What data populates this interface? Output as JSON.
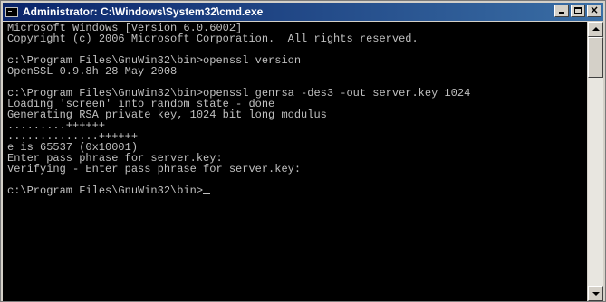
{
  "window": {
    "title": "Administrator: C:\\Windows\\System32\\cmd.exe",
    "app_icon": "cmd-console-icon",
    "controls": {
      "minimize": "minimize-icon",
      "maximize": "maximize-icon",
      "close": "×"
    }
  },
  "console": {
    "foreground": "#c0c0c0",
    "background": "#000000",
    "lines": [
      "Microsoft Windows [Version 6.0.6002]",
      "Copyright (c) 2006 Microsoft Corporation.  All rights reserved.",
      "",
      "c:\\Program Files\\GnuWin32\\bin>openssl version",
      "OpenSSL 0.9.8h 28 May 2008",
      "",
      "c:\\Program Files\\GnuWin32\\bin>openssl genrsa -des3 -out server.key 1024",
      "Loading 'screen' into random state - done",
      "Generating RSA private key, 1024 bit long modulus",
      ".........++++++",
      "..............++++++",
      "e is 65537 (0x10001)",
      "Enter pass phrase for server.key:",
      "Verifying - Enter pass phrase for server.key:",
      "",
      "c:\\Program Files\\GnuWin32\\bin>"
    ]
  }
}
